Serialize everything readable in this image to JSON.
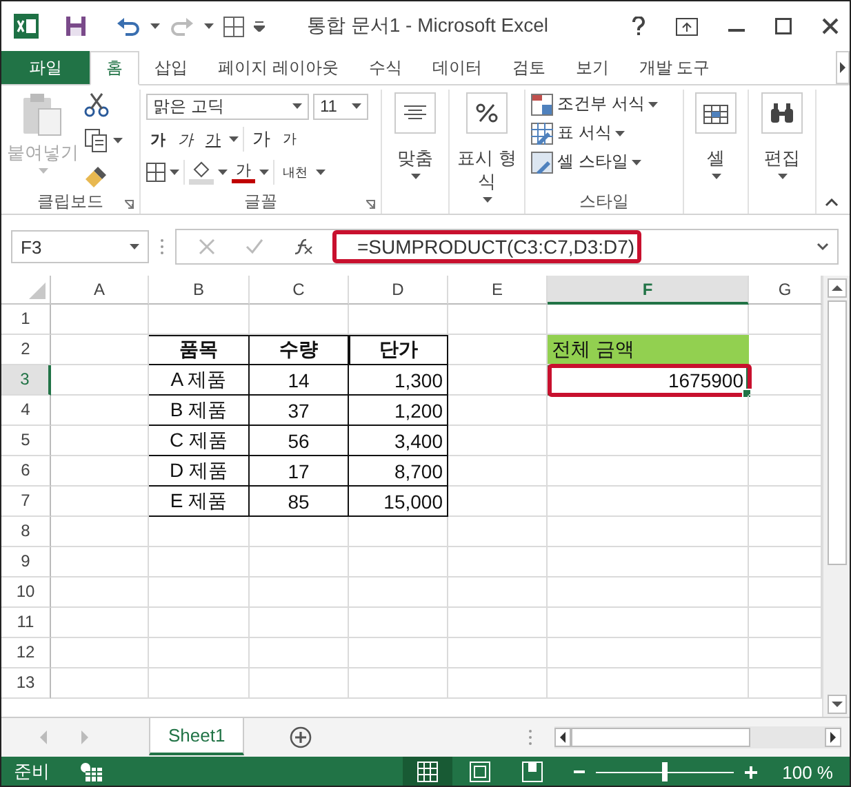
{
  "title_bar": {
    "title": "통합 문서1 - Microsoft Excel"
  },
  "ribbon_tabs": [
    {
      "label": "파일",
      "kind": "file",
      "selected": false
    },
    {
      "label": "홈",
      "kind": "tab",
      "selected": true
    },
    {
      "label": "삽입",
      "kind": "tab",
      "selected": false
    },
    {
      "label": "페이지 레이아웃",
      "kind": "tab",
      "selected": false
    },
    {
      "label": "수식",
      "kind": "tab",
      "selected": false
    },
    {
      "label": "데이터",
      "kind": "tab",
      "selected": false
    },
    {
      "label": "검토",
      "kind": "tab",
      "selected": false
    },
    {
      "label": "보기",
      "kind": "tab",
      "selected": false
    },
    {
      "label": "개발 도구",
      "kind": "tab",
      "selected": false
    }
  ],
  "ribbon": {
    "clipboard": {
      "label": "클립보드",
      "paste": {
        "label": "붙여넣기",
        "disabled": true
      }
    },
    "font": {
      "label": "글꼴",
      "font_name": "맑은 고딕",
      "font_size": "11",
      "bold": "가",
      "italic": "가",
      "underline": "가",
      "grow": "가",
      "shrink": "가",
      "font_color": "가",
      "phonetic": "내천"
    },
    "alignment": {
      "label": "맞춤"
    },
    "number": {
      "label": "표시 형식"
    },
    "styles": {
      "label": "스타일",
      "items": [
        "조건부 서식",
        "표 서식",
        "셀 스타일"
      ]
    },
    "cells": {
      "label": "셀"
    },
    "editing": {
      "label": "편집"
    }
  },
  "formula_bar": {
    "name_box": "F3",
    "formula": "=SUMPRODUCT(C3:C7,D3:D7)",
    "highlighted": true
  },
  "sheet": {
    "columns": [
      {
        "label": "A",
        "selected": false
      },
      {
        "label": "B",
        "selected": false
      },
      {
        "label": "C",
        "selected": false
      },
      {
        "label": "D",
        "selected": false
      },
      {
        "label": "E",
        "selected": false
      },
      {
        "label": "F",
        "selected": true
      },
      {
        "label": "G",
        "selected": false
      }
    ],
    "rows": [
      {
        "label": "1",
        "selected": false,
        "cells": []
      },
      {
        "label": "2",
        "selected": false,
        "cells": [
          "",
          {
            "kind": "header",
            "text": "품목"
          },
          {
            "kind": "header",
            "text": "수량"
          },
          {
            "kind": "header",
            "text": "단가"
          },
          "",
          {
            "kind": "label",
            "text": "전체 금액"
          }
        ]
      },
      {
        "label": "3",
        "selected": true,
        "cells": [
          "",
          {
            "kind": "item",
            "text": "A 제품"
          },
          {
            "kind": "item",
            "text": "14"
          },
          {
            "kind": "number",
            "text": "1,300"
          },
          "",
          {
            "kind": "result",
            "text": "1675900",
            "selected": true,
            "highlighted": true
          }
        ]
      },
      {
        "label": "4",
        "selected": false,
        "cells": [
          "",
          {
            "kind": "item",
            "text": "B 제품"
          },
          {
            "kind": "item",
            "text": "37"
          },
          {
            "kind": "number",
            "text": "1,200"
          }
        ]
      },
      {
        "label": "5",
        "selected": false,
        "cells": [
          "",
          {
            "kind": "item",
            "text": "C 제품"
          },
          {
            "kind": "item",
            "text": "56"
          },
          {
            "kind": "number",
            "text": "3,400"
          }
        ]
      },
      {
        "label": "6",
        "selected": false,
        "cells": [
          "",
          {
            "kind": "item",
            "text": "D 제품"
          },
          {
            "kind": "item",
            "text": "17"
          },
          {
            "kind": "number",
            "text": "8,700"
          }
        ]
      },
      {
        "label": "7",
        "selected": false,
        "cells": [
          "",
          {
            "kind": "item",
            "text": "E 제품"
          },
          {
            "kind": "item",
            "text": "85"
          },
          {
            "kind": "number",
            "text": "15,000"
          }
        ]
      },
      {
        "label": "8",
        "selected": false,
        "cells": []
      },
      {
        "label": "9",
        "selected": false,
        "cells": []
      },
      {
        "label": "10",
        "selected": false,
        "cells": []
      },
      {
        "label": "11",
        "selected": false,
        "cells": []
      },
      {
        "label": "12",
        "selected": false,
        "cells": []
      },
      {
        "label": "13",
        "selected": false,
        "cells": []
      }
    ]
  },
  "sheet_tabs": [
    {
      "label": "Sheet1",
      "selected": true
    }
  ],
  "status_bar": {
    "status": "준비",
    "views": [
      {
        "kind": "normal",
        "selected": true
      },
      {
        "kind": "layout",
        "selected": false
      },
      {
        "kind": "break",
        "selected": false
      }
    ],
    "zoom": {
      "level": 0.5,
      "reading": "100 %"
    }
  }
}
